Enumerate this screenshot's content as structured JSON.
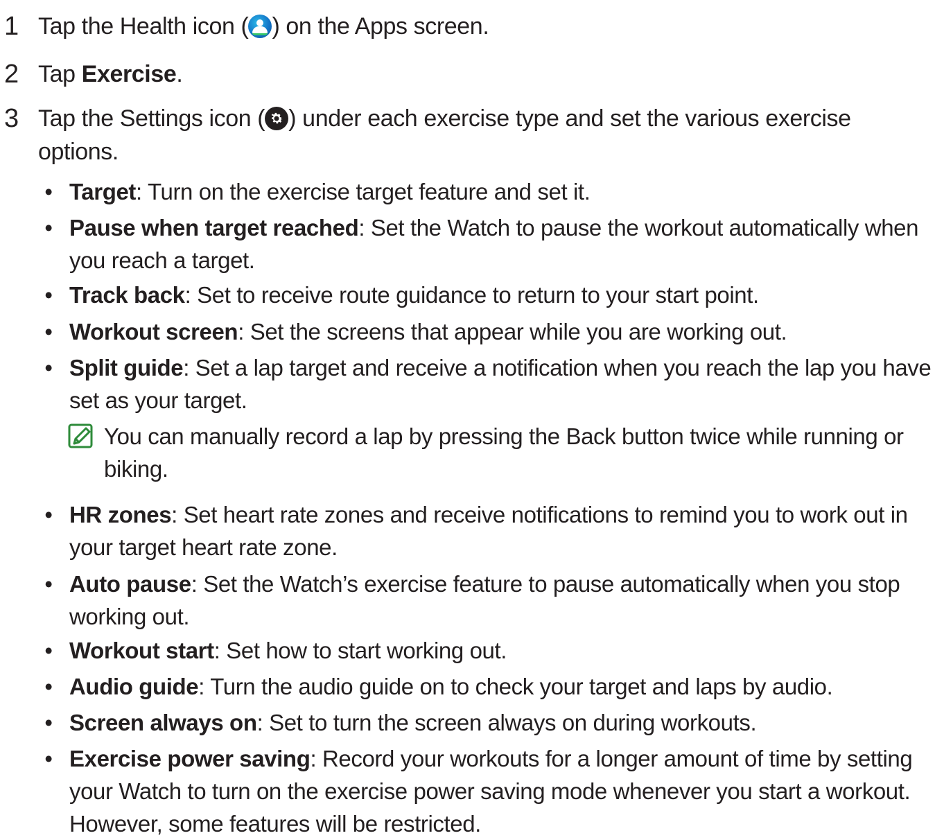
{
  "steps": [
    {
      "num": "1",
      "before": "Tap the Health icon (",
      "after": ") on the Apps screen."
    },
    {
      "num": "2",
      "before": "Tap ",
      "bold": "Exercise",
      "after": "."
    },
    {
      "num": "3",
      "before": "Tap the Settings icon (",
      "after": ") under each exercise type and set the various exercise options."
    }
  ],
  "bullets": [
    {
      "term": "Target",
      "desc": ": Turn on the exercise target feature and set it."
    },
    {
      "term": "Pause when target reached",
      "desc": ": Set the Watch to pause the workout automatically when you reach a target."
    },
    {
      "term": "Track back",
      "desc": ": Set to receive route guidance to return to your start point."
    },
    {
      "term": "Workout screen",
      "desc": ": Set the screens that appear while you are working out."
    },
    {
      "term": "Split guide",
      "desc": ": Set a lap target and receive a notification when you reach the lap you have set as your target."
    },
    {
      "term": "HR zones",
      "desc": ": Set heart rate zones and receive notifications to remind you to work out in your target heart rate zone."
    },
    {
      "term": "Auto pause",
      "desc": ": Set the Watch’s exercise feature to pause automatically when you stop working out."
    },
    {
      "term": "Workout start",
      "desc": ": Set how to start working out."
    },
    {
      "term": "Audio guide",
      "desc": ": Turn the audio guide on to check your target and laps by audio."
    },
    {
      "term": "Screen always on",
      "desc": ": Set to turn the screen always on during workouts."
    },
    {
      "term": "Exercise power saving",
      "desc": ": Record your workouts for a longer amount of time by setting your Watch to turn on the exercise power saving mode whenever you start a workout. However, some features will be restricted."
    }
  ],
  "note": {
    "text": "You can manually record a lap by pressing the Back button twice while running or biking.",
    "icon": "note-pencil-icon",
    "icon_color": "#2e8b3a"
  },
  "bullet_char": "•",
  "icons": {
    "health": "health-app-icon",
    "settings": "settings-gear-icon"
  }
}
